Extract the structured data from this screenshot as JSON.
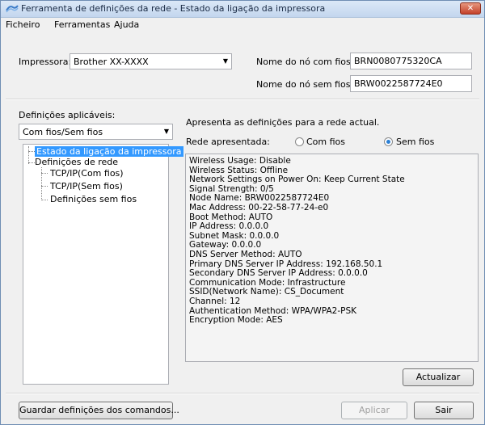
{
  "window": {
    "title": "Ferramenta de definições da rede - Estado da ligação da impressora",
    "close_glyph": "✕"
  },
  "menu": [
    "Ficheiro",
    "Ferramentas",
    "Ajuda"
  ],
  "printer": {
    "label": "Impressora:",
    "value": "Brother XX-XXXX"
  },
  "nodes": {
    "wired_label": "Nome do nó com fios:",
    "wired_value": "BRN0080775320CA",
    "wireless_label": "Nome do nó sem fios:",
    "wireless_value": "BRW0022587724E0"
  },
  "left": {
    "settings_label": "Definições aplicáveis:",
    "mode_value": "Com fios/Sem fios",
    "tree": {
      "root": "Estado da ligação da impressora",
      "network": "Definições de rede",
      "tcp_wired": "TCP/IP(Com fios)",
      "tcp_wireless": "TCP/IP(Sem fios)",
      "wireless_settings": "Definições sem fios"
    }
  },
  "right": {
    "description": "Apresenta as definições para a rede actual.",
    "network_label": "Rede apresentada:",
    "radio_wired": "Com fios",
    "radio_wireless": "Sem fios",
    "selected": "Sem fios",
    "info_lines": [
      "Wireless Usage: Disable",
      "Wireless Status: Offline",
      "Network Settings on Power On: Keep Current State",
      "Signal Strength: 0/5",
      "Node Name: BRW0022587724E0",
      "Mac Address: 00-22-58-77-24-e0",
      "Boot Method: AUTO",
      "IP Address: 0.0.0.0",
      "Subnet Mask: 0.0.0.0",
      "Gateway: 0.0.0.0",
      "DNS Server Method: AUTO",
      "Primary DNS Server IP Address: 192.168.50.1",
      "Secondary DNS Server IP Address: 0.0.0.0",
      "Communication Mode: Infrastructure",
      "SSID(Network Name): CS_Document",
      "Channel: 12",
      "Authentication Method: WPA/WPA2-PSK",
      "Encryption Mode: AES"
    ],
    "refresh_label": "Actualizar"
  },
  "footer": {
    "save_label": "Guardar definições dos comandos...",
    "apply_label": "Aplicar",
    "exit_label": "Sair"
  }
}
